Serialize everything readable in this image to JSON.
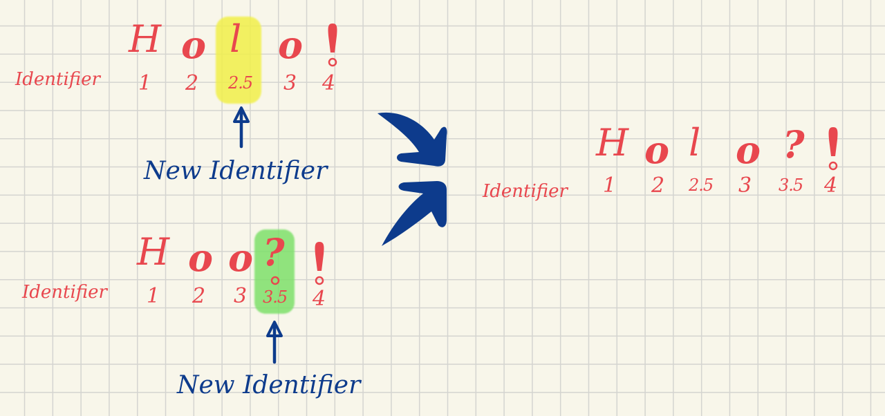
{
  "colors": {
    "paper": "#f8f6ea",
    "grid": "#d4d4d0",
    "ink_red": "#e8474e",
    "ink_blue": "#0d3b8c",
    "highlight_yellow": "#f1f04a",
    "highlight_green": "#7ee06b"
  },
  "top": {
    "chars": [
      "H",
      "o",
      "l",
      "o"
    ],
    "identifier_label": "Identifier",
    "ids": [
      "1",
      "2",
      "2.5",
      "3",
      "4"
    ],
    "new_identifier_label": "New Identifier"
  },
  "bottom": {
    "chars": [
      "H",
      "o",
      "o",
      "?"
    ],
    "identifier_label": "Identifier",
    "ids": [
      "1",
      "2",
      "3",
      "3.5",
      "4"
    ],
    "new_identifier_label": "New Identifier"
  },
  "result": {
    "chars": [
      "H",
      "o",
      "l",
      "o",
      "?"
    ],
    "identifier_label": "Identifier",
    "ids": [
      "1",
      "2",
      "2.5",
      "3",
      "3.5",
      "4"
    ]
  },
  "icons": {
    "merge_arrows": "merge-arrows-icon",
    "up_arrow": "up-arrow-icon",
    "end_marker": "exclamation-end-icon"
  }
}
